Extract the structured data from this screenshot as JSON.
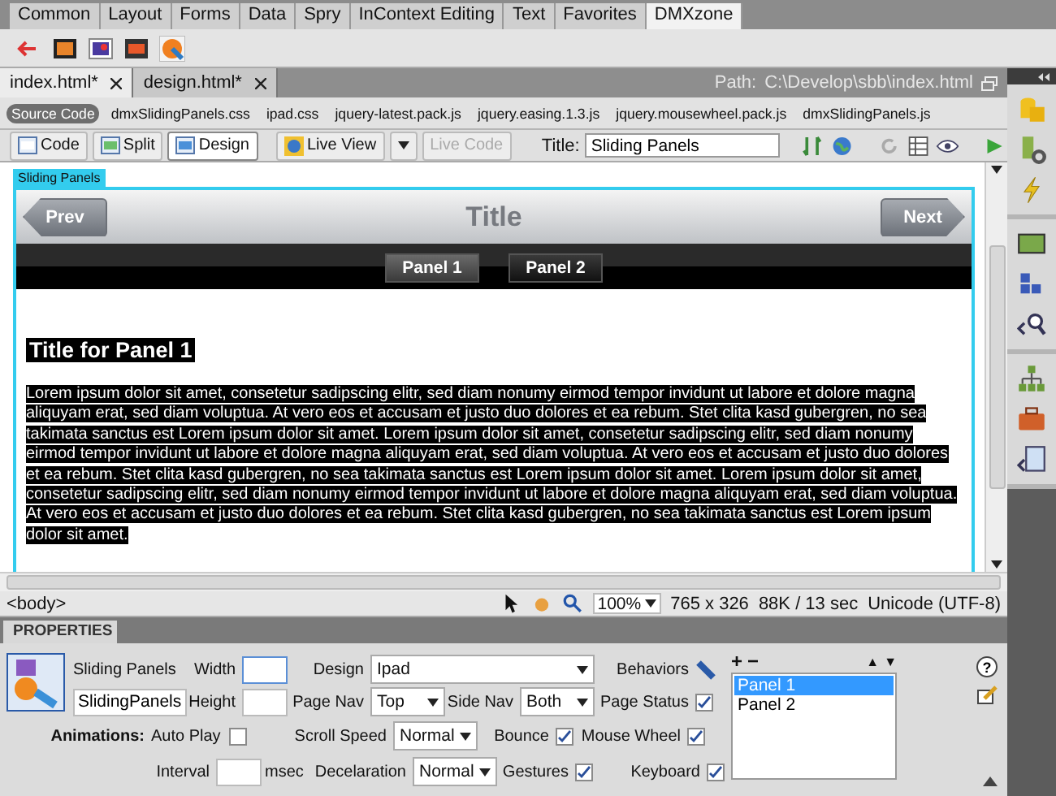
{
  "insert_bar": {
    "tabs": [
      {
        "label": "Common",
        "selected": false
      },
      {
        "label": "Layout",
        "selected": false
      },
      {
        "label": "Forms",
        "selected": false
      },
      {
        "label": "Data",
        "selected": false
      },
      {
        "label": "Spry",
        "selected": false
      },
      {
        "label": "InContext Editing",
        "selected": false
      },
      {
        "label": "Text",
        "selected": false
      },
      {
        "label": "Favorites",
        "selected": false
      },
      {
        "label": "DMXzone",
        "selected": true
      }
    ]
  },
  "document_tabs": [
    {
      "label": "index.html*",
      "selected": true
    },
    {
      "label": "design.html*",
      "selected": false
    }
  ],
  "path": {
    "label": "Path:",
    "value": "C:\\Develop\\sbb\\index.html"
  },
  "related_files": [
    {
      "label": "Source Code",
      "selected": true
    },
    {
      "label": "dmxSlidingPanels.css",
      "selected": false
    },
    {
      "label": "ipad.css",
      "selected": false
    },
    {
      "label": "jquery-latest.pack.js",
      "selected": false
    },
    {
      "label": "jquery.easing.1.3.js",
      "selected": false
    },
    {
      "label": "jquery.mousewheel.pack.js",
      "selected": false
    },
    {
      "label": "dmxSlidingPanels.js",
      "selected": false
    }
  ],
  "document_toolbar": {
    "views": [
      {
        "label": "Code",
        "selected": false
      },
      {
        "label": "Split",
        "selected": false
      },
      {
        "label": "Design",
        "selected": true
      }
    ],
    "live_view": "Live View",
    "live_code": {
      "label": "Live Code",
      "disabled": true
    },
    "title_label": "Title:",
    "title_value": "Sliding Panels"
  },
  "design_view": {
    "widget_tag": "Sliding Panels",
    "prev": "Prev",
    "title": "Title",
    "next": "Next",
    "panel_tabs": [
      {
        "label": "Panel 1",
        "selected": true
      },
      {
        "label": "Panel 2",
        "selected": false
      }
    ],
    "heading": "Title for Panel 1",
    "body": "Lorem ipsum dolor sit amet, consetetur sadipscing elitr, sed diam nonumy eirmod tempor invidunt ut labore et dolore magna aliquyam erat, sed diam voluptua. At vero eos et accusam et justo duo dolores et ea rebum. Stet clita kasd gubergren, no sea takimata sanctus est Lorem ipsum dolor sit amet. Lorem ipsum dolor sit amet, consetetur sadipscing elitr, sed diam nonumy eirmod tempor invidunt ut labore et dolore magna aliquyam erat, sed diam voluptua. At vero eos et accusam et justo duo dolores et ea rebum. Stet clita kasd gubergren, no sea takimata sanctus est Lorem ipsum dolor sit amet. Lorem ipsum dolor sit amet, consetetur sadipscing elitr, sed diam nonumy eirmod tempor invidunt ut labore et dolore magna aliquyam erat, sed diam voluptua. At vero eos et accusam et justo duo dolores et ea rebum. Stet clita kasd gubergren, no sea takimata sanctus est Lorem ipsum dolor sit amet."
  },
  "status_bar": {
    "tag": "<body>",
    "zoom": "100%",
    "dimensions": "765 x 326",
    "download": "88K / 13 sec",
    "encoding": "Unicode (UTF-8)"
  },
  "properties": {
    "title": "PROPERTIES",
    "widget_type": "Sliding Panels",
    "id": "SlidingPanels",
    "width_label": "Width",
    "height_label": "Height",
    "design_label": "Design",
    "design": "Ipad",
    "page_nav_label": "Page Nav",
    "page_nav": "Top",
    "side_nav_label": "Side Nav",
    "side_nav": "Both",
    "behaviors_label": "Behaviors",
    "page_status": {
      "label": "Page Status",
      "checked": true
    },
    "animations_label": "Animations:",
    "auto_play": {
      "label": "Auto Play",
      "checked": false
    },
    "interval_label": "Interval",
    "msec_label": "msec",
    "scroll_speed_label": "Scroll Speed",
    "scroll_speed": "Normal",
    "deceleration_label": "Decelaration",
    "deceleration": "Normal",
    "bounce": {
      "label": "Bounce",
      "checked": true
    },
    "gestures": {
      "label": "Gestures",
      "checked": true
    },
    "mouse_wheel": {
      "label": "Mouse Wheel",
      "checked": true
    },
    "keyboard": {
      "label": "Keyboard",
      "checked": true
    },
    "add": "+",
    "remove": "−",
    "up": "▲",
    "down": "▼",
    "help": "?",
    "panels": [
      {
        "label": "Panel 1",
        "selected": true
      },
      {
        "label": "Panel 2",
        "selected": false
      }
    ]
  }
}
